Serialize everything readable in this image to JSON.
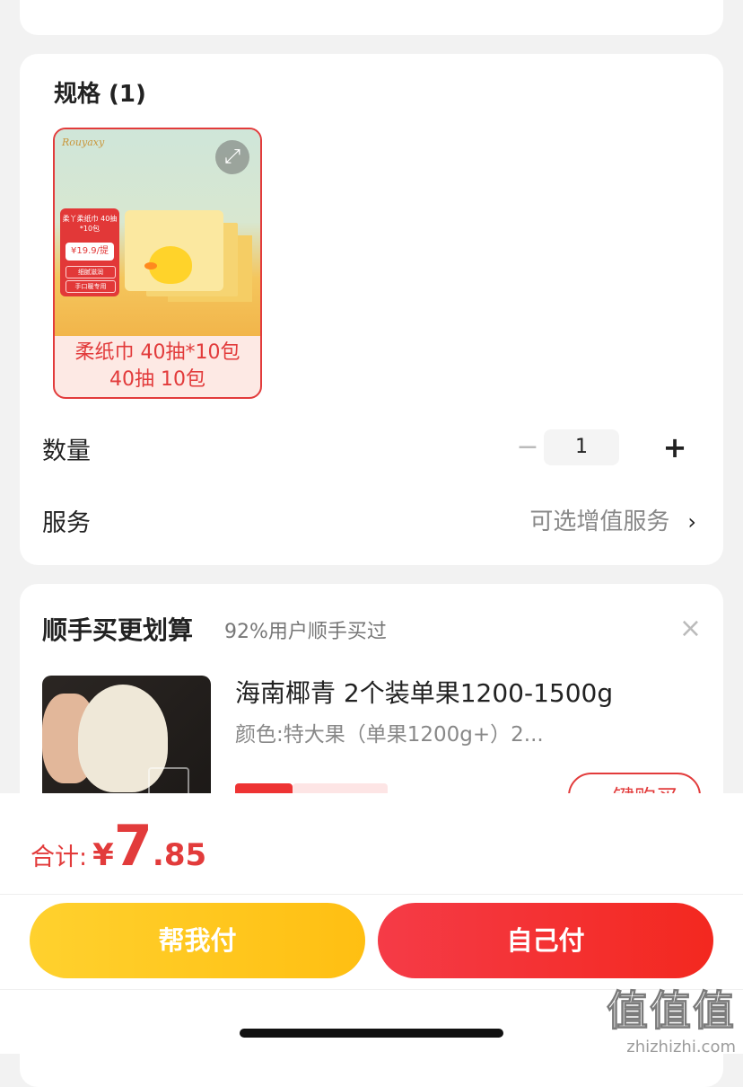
{
  "spec": {
    "title": "规格 (1)",
    "item_caption_line1": "柔纸巾 40抽*10包",
    "item_caption_line2": "40抽 10包",
    "product_image": {
      "brand_text": "Rouyaxy",
      "promo_line": "柔丫柔纸巾 40抽*10包",
      "promo_price": "¥19.9/提",
      "promo_tags": [
        "细腻滋润",
        "手口暖专用"
      ]
    }
  },
  "quantity": {
    "label": "数量",
    "minus": "−",
    "value": "1",
    "plus": "+"
  },
  "service": {
    "label": "服务",
    "value": "可选增值服务",
    "chevron": "›"
  },
  "recommend": {
    "title": "顺手买更划算",
    "subtitle": "92%用户顺手买过",
    "close": "×",
    "item": {
      "name": "海南椰青 2个装单果1200-1500g",
      "spec": "颜色:特大果（单果1200g+）2...",
      "buy_label": "一键购买"
    }
  },
  "footer": {
    "total_label": "合计:",
    "currency": "¥",
    "total_int": "7",
    "total_dec": ".85",
    "help_pay": "帮我付",
    "self_pay": "自己付"
  },
  "watermark": {
    "big": "值值值",
    "small": "zhizhizhi.com"
  },
  "colors": {
    "accent_red": "#e23b3b",
    "yellow_button": "#ffc81f",
    "red_button": "#f5322f"
  }
}
